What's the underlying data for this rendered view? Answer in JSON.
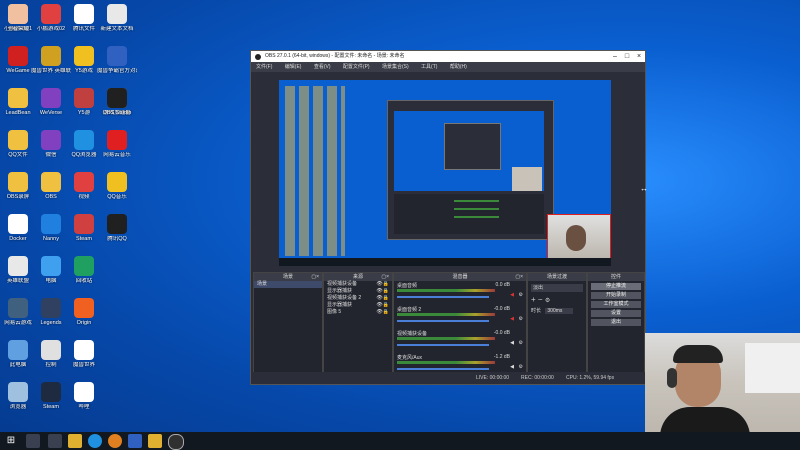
{
  "desktop": {
    "icons": [
      {
        "label": "小鹏游戏01",
        "color": "#f0b020"
      },
      {
        "label": "小鹏游戏02",
        "color": "#e04040"
      },
      {
        "label": "腾讯文件",
        "color": "#ffffff"
      },
      {
        "label": "新建文本文档",
        "color": "#e8e8e8"
      },
      {
        "label": "WeGame",
        "color": "#d02020"
      },
      {
        "label": "魔兽世界 英雄联盟",
        "color": "#d0a020"
      },
      {
        "label": "Y5游戏",
        "color": "#f0c020"
      },
      {
        "label": "魔兽争霸官方对战平台",
        "color": "#3060c0"
      },
      {
        "label": "LeadBean",
        "color": "#f0c040"
      },
      {
        "label": "WeVerse",
        "color": "#8040c0"
      },
      {
        "label": "Y5游",
        "color": "#c04040"
      },
      {
        "label": "游戏加速器",
        "color": "#f08020"
      },
      {
        "label": "QQ文件",
        "color": "#f0c040"
      },
      {
        "label": "微信",
        "color": "#8040c0"
      },
      {
        "label": "QQ浏览器",
        "color": "#2090e0"
      },
      {
        "label": "OBS录屏",
        "color": "#f0c040"
      },
      {
        "label": "OBS",
        "color": "#f0c040"
      },
      {
        "label": "视频",
        "color": "#e04040"
      },
      {
        "label": "Docker",
        "color": "#ffffff"
      },
      {
        "label": "Nanny",
        "color": "#2080e0"
      },
      {
        "label": "Steam",
        "color": "#d04040"
      },
      {
        "label": "英雄联盟",
        "color": "#e8e8e8"
      },
      {
        "label": "电脑",
        "color": "#40a0f0"
      },
      {
        "label": "回收站",
        "color": "#20a060"
      },
      {
        "label": "网易云游戏",
        "color": "#406080"
      },
      {
        "label": "Legends",
        "color": "#304060"
      },
      {
        "label": "Origin",
        "color": "#f06020"
      },
      {
        "label": "此电脑",
        "color": "#60a0e0"
      },
      {
        "label": "控制",
        "color": "#e0e0e0"
      },
      {
        "label": "魔兽世界",
        "color": "#ffffff"
      },
      {
        "label": "浏览器",
        "color": "#a0c0e0"
      },
      {
        "label": "Steam",
        "color": "#1e2a40"
      },
      {
        "label": "哔哩",
        "color": "#ffffff"
      },
      {
        "label": "OBS Studio",
        "color": "#202020"
      },
      {
        "label": "网易云音乐",
        "color": "#e02020"
      },
      {
        "label": "QQ音乐",
        "color": "#f0c020"
      },
      {
        "label": "腾讯QQ",
        "color": "#202020"
      },
      {
        "label": "王者荣耀",
        "color": "#f0c0a0"
      }
    ]
  },
  "obs": {
    "title": "OBS 27.0.1 (64-bit, windows) - 配置文件: 未命名 - 场景: 未命名",
    "menu": [
      "文件(F)",
      "编辑(E)",
      "查看(V)",
      "配置文件(P)",
      "场景集合(S)",
      "工具(T)",
      "帮助(H)"
    ],
    "docks": {
      "scenes": {
        "title": "场景",
        "items": [
          "场景"
        ]
      },
      "sources": {
        "title": "来源",
        "items": [
          "视频捕获设备",
          "显示器捕获",
          "视频捕获设备 2",
          "显示器捕获",
          "图像 5"
        ]
      },
      "mixer": {
        "title": "混音器",
        "channels": [
          {
            "name": "桌面音频",
            "db": "0.0 dB"
          },
          {
            "name": "桌面音频 2",
            "db": "-0.0 dB"
          },
          {
            "name": "视频捕获设备",
            "db": "-0.0 dB"
          },
          {
            "name": "麦克风/Aux",
            "db": "-1.2 dB"
          }
        ]
      },
      "transitions": {
        "title": "场景过渡",
        "mode": "淡出",
        "duration_label": "时长",
        "duration": "300ms"
      },
      "controls": {
        "title": "控件",
        "buttons": [
          "停止推流",
          "开始录制",
          "工作室模式",
          "设置",
          "退出"
        ]
      }
    },
    "status": {
      "live": "LIVE: 00:00:00",
      "rec": "REC: 00:00:00",
      "cpu": "CPU: 1.2%, 59.94 fps"
    }
  },
  "taskbar": {
    "items": [
      "start",
      "search",
      "task-view",
      "file-explorer",
      "edge",
      "chrome",
      "obs",
      "folder",
      "clock-app"
    ]
  }
}
